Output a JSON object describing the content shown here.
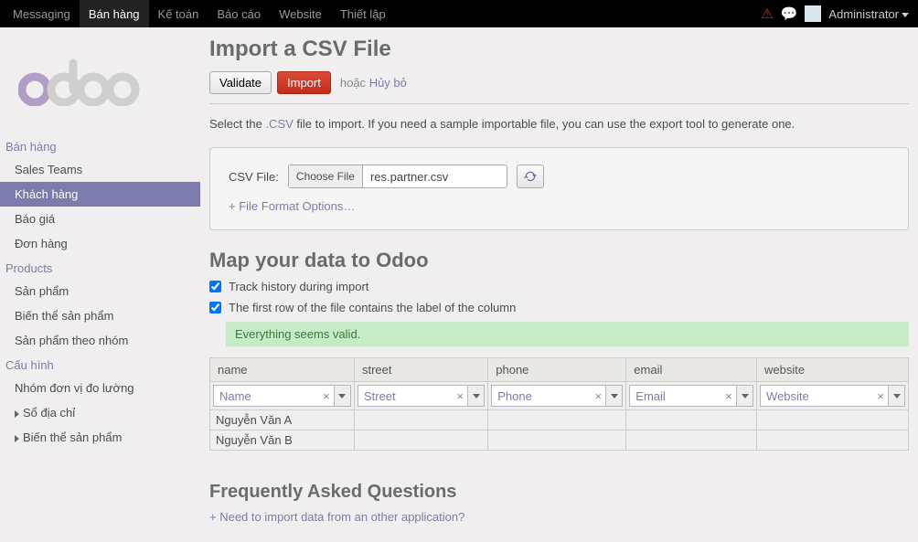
{
  "nav": {
    "items": [
      "Messaging",
      "Bán hàng",
      "Kế toán",
      "Báo cáo",
      "Website",
      "Thiết lập"
    ],
    "active_index": 1,
    "admin": "Administrator"
  },
  "sidebar": {
    "sections": [
      {
        "title": "Bán hàng",
        "items": [
          {
            "label": "Sales Teams",
            "selected": false
          },
          {
            "label": "Khách hàng",
            "selected": true
          },
          {
            "label": "Báo giá",
            "selected": false
          },
          {
            "label": "Đơn hàng",
            "selected": false
          }
        ]
      },
      {
        "title": "Products",
        "items": [
          {
            "label": "Sản phẩm",
            "selected": false
          },
          {
            "label": "Biến thể sản phẩm",
            "selected": false
          },
          {
            "label": "Sản phẩm theo nhóm",
            "selected": false
          }
        ]
      },
      {
        "title": "Cấu hình",
        "items": [
          {
            "label": "Nhóm đơn vị đo lường",
            "selected": false
          },
          {
            "label": "Sổ địa chỉ",
            "selected": false,
            "expandable": true
          },
          {
            "label": "Biến thể sản phẩm",
            "selected": false,
            "expandable": true
          }
        ]
      }
    ]
  },
  "page": {
    "title": "Import a CSV File",
    "validate_label": "Validate",
    "import_label": "Import",
    "or_text": "hoặc",
    "cancel_text": "Hủy bỏ",
    "instruction_pre": "Select the ",
    "instruction_csv": ".CSV",
    "instruction_post": " file to import. If you need a sample importable file, you can use the export tool to generate one.",
    "csv_file_label": "CSV File:",
    "choose_file_label": "Choose File",
    "filename": "res.partner.csv",
    "format_options": "+ File Format Options…",
    "map_title": "Map your data to Odoo",
    "chk_track": "Track history during import",
    "chk_firstrow": "The first row of the file contains the label of the column",
    "valid_msg": "Everything seems valid.",
    "faq_title": "Frequently Asked Questions",
    "faq_link": "+ Need to import data from an other application?"
  },
  "table": {
    "headers": [
      "name",
      "street",
      "phone",
      "email",
      "website"
    ],
    "fields": [
      "Name",
      "Street",
      "Phone",
      "Email",
      "Website"
    ],
    "rows": [
      [
        "Nguyễn Văn A",
        "",
        "",
        "",
        ""
      ],
      [
        "Nguyễn Văn B",
        "",
        "",
        "",
        ""
      ]
    ]
  }
}
